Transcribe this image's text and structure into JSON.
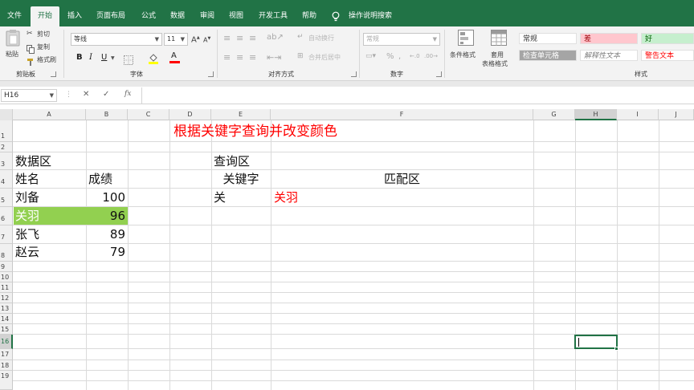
{
  "tabs": [
    {
      "label": "文件",
      "active": false
    },
    {
      "label": "开始",
      "active": true
    },
    {
      "label": "插入",
      "active": false
    },
    {
      "label": "页面布局",
      "active": false
    },
    {
      "label": "公式",
      "active": false
    },
    {
      "label": "数据",
      "active": false
    },
    {
      "label": "审阅",
      "active": false
    },
    {
      "label": "视图",
      "active": false
    },
    {
      "label": "开发工具",
      "active": false
    },
    {
      "label": "帮助",
      "active": false
    }
  ],
  "tell_me": "操作说明搜索",
  "ribbon": {
    "clipboard": {
      "paste": "粘贴",
      "cut": "剪切",
      "copy": "复制",
      "format_painter": "格式刷",
      "group_label": "剪贴板"
    },
    "font": {
      "name": "等线",
      "size": "11",
      "bold": "B",
      "italic": "I",
      "underline": "U",
      "font_color_letter": "A",
      "group_label": "字体"
    },
    "alignment": {
      "wrap_text": "自动换行",
      "merge_center": "合并后居中",
      "group_label": "对齐方式"
    },
    "number": {
      "format": "常规",
      "group_label": "数字"
    },
    "styles": {
      "conditional_format": "条件格式",
      "table_format_line1": "套用",
      "table_format_line2": "表格格式",
      "cell_styles": [
        {
          "label": "常规",
          "bg": "#ffffff",
          "color": "#333333"
        },
        {
          "label": "差",
          "bg": "#ffc7ce",
          "color": "#9c0006"
        },
        {
          "label": "好",
          "bg": "#c6efce",
          "color": "#006100"
        },
        {
          "label": "检查单元格",
          "bg": "#a5a5a5",
          "color": "#ffffff"
        },
        {
          "label": "解释性文本",
          "bg": "#ffffff",
          "color": "#7f7f7f"
        },
        {
          "label": "警告文本",
          "bg": "#ffffff",
          "color": "#ff0000"
        }
      ],
      "group_label": "样式"
    }
  },
  "formula_bar": {
    "name_box": "H16",
    "cancel": "✕",
    "enter": "✓",
    "fx": "fx",
    "content": ""
  },
  "columns": [
    "A",
    "B",
    "C",
    "D",
    "E",
    "F",
    "G",
    "H",
    "I",
    "J"
  ],
  "rows": [
    "1",
    "2",
    "3",
    "4",
    "5",
    "6",
    "7",
    "8",
    "9",
    "10",
    "11",
    "12",
    "13",
    "14",
    "15",
    "16",
    "17",
    "18",
    "19"
  ],
  "active_cell": "H16",
  "sheet": {
    "title": "根据关键字查询并改变颜色",
    "data_area_label": "数据区",
    "header_name": "姓名",
    "header_score": "成绩",
    "records": [
      {
        "name": "刘备",
        "score": "100",
        "highlighted": false
      },
      {
        "name": "关羽",
        "score": "96",
        "highlighted": true
      },
      {
        "name": "张飞",
        "score": "89",
        "highlighted": false
      },
      {
        "name": "赵云",
        "score": "79",
        "highlighted": false
      }
    ],
    "query_area_label": "查询区",
    "keyword_header": "关键字",
    "match_header": "匹配区",
    "keyword_value": "关",
    "match_value": "关羽"
  },
  "colors": {
    "accent": "#217346",
    "highlight_fill": "#92d050",
    "title_text": "#ff0000",
    "match_text": "#ff0000"
  }
}
